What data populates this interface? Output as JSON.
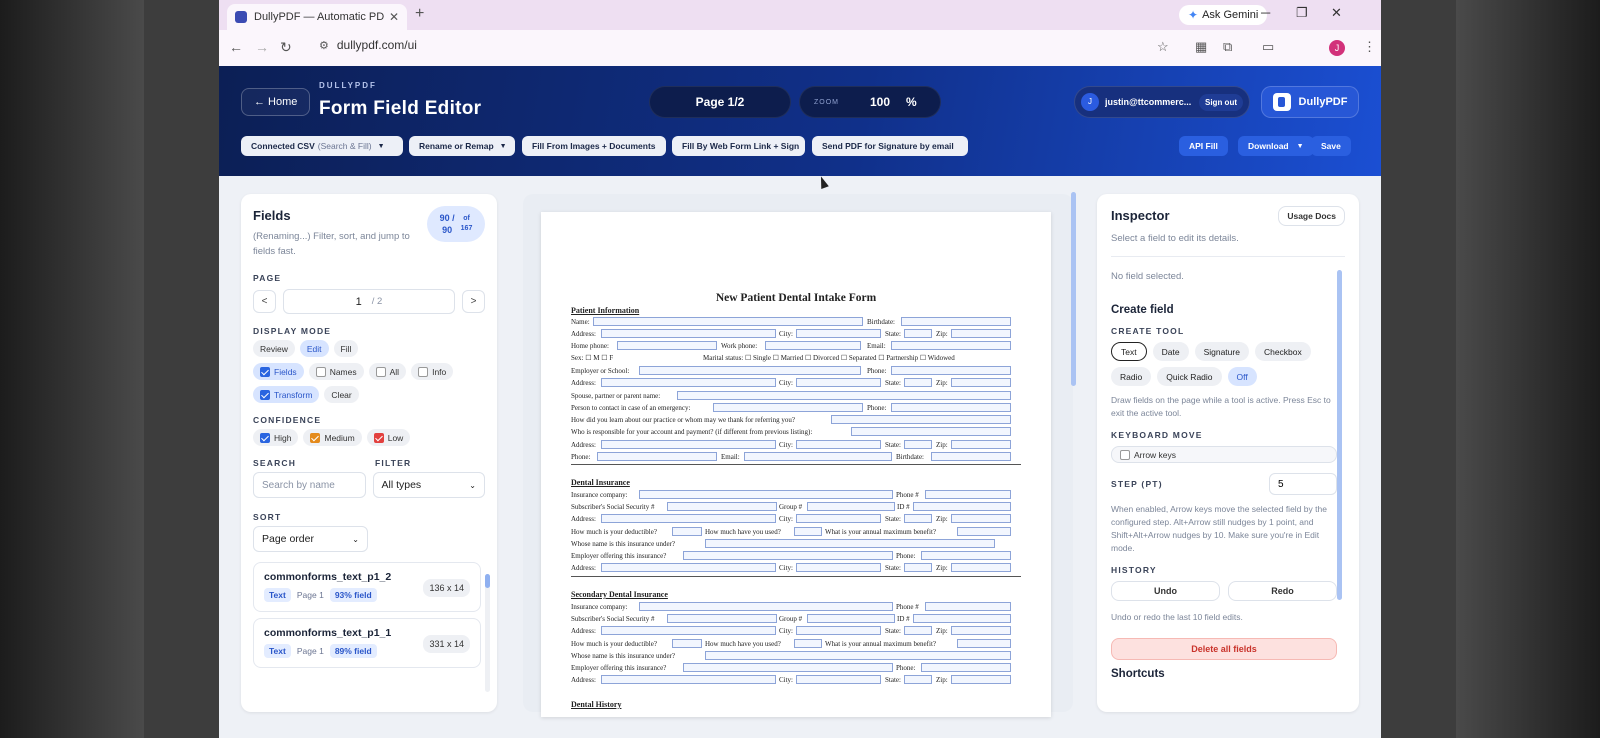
{
  "browser": {
    "tab_title": "DullyPDF — Automatic PDF to F",
    "tab_close": "✕",
    "new_tab": "+",
    "gemini": "Ask Gemini",
    "url": "dullypdf.com/ui",
    "profile_initial": "J"
  },
  "header": {
    "home": "← Home",
    "brand": "DULLYPDF",
    "title": "Form Field Editor",
    "page_indicator": "Page 1/2",
    "zoom_label": "ZOOM",
    "zoom_value": "100",
    "zoom_unit": "%",
    "user_initial": "J",
    "user_email": "justin@ttcommerc...",
    "sign_out": "Sign out",
    "product": "DullyPDF"
  },
  "toolbar": {
    "connected_csv": "Connected CSV",
    "connected_csv_hint": "(Search & Fill)",
    "rename_remap": "Rename or Remap",
    "fill_images": "Fill From Images + Documents",
    "fill_web": "Fill By Web Form Link + Sign",
    "send_sig": "Send PDF for Signature by email",
    "api_fill": "API Fill",
    "download": "Download",
    "save": "Save"
  },
  "fields_panel": {
    "title": "Fields",
    "subtitle": "(Renaming...) Filter, sort, and jump to fields fast.",
    "count_a": "90 /",
    "count_b": "90",
    "count_of": "of",
    "count_total": "167",
    "page_label": "PAGE",
    "page_current": "1",
    "page_of": "/ 2",
    "prev": "<",
    "next": ">",
    "display_mode_label": "DISPLAY MODE",
    "modes": [
      "Review",
      "Edit",
      "Fill"
    ],
    "toggles": [
      "Fields",
      "Names",
      "All",
      "Info"
    ],
    "transform": "Transform",
    "clear": "Clear",
    "confidence_label": "CONFIDENCE",
    "confidence": [
      "High",
      "Medium",
      "Low"
    ],
    "search_label": "SEARCH",
    "search_placeholder": "Search by name",
    "filter_label": "FILTER",
    "filter_value": "All types",
    "sort_label": "SORT",
    "sort_value": "Page order",
    "items": [
      {
        "name": "commonforms_text_p1_2",
        "type": "Text",
        "page": "Page 1",
        "conf": "93% field",
        "size": "136 x 14"
      },
      {
        "name": "commonforms_text_p1_1",
        "type": "Text",
        "page": "Page 1",
        "conf": "89% field",
        "size": "331 x 14"
      }
    ]
  },
  "document": {
    "title": "New Patient Dental Intake Form",
    "sections": [
      "Patient Information",
      "Dental Insurance",
      "Secondary Dental Insurance",
      "Dental History"
    ],
    "labels": {
      "name": "Name:",
      "birthdate": "Birthdate:",
      "address": "Address:",
      "city": "City:",
      "state": "State:",
      "zip": "Zip:",
      "home_phone": "Home phone:",
      "work_phone": "Work phone:",
      "email": "Email:",
      "sex": "Sex:",
      "m": "M",
      "f": "F",
      "marital": "Marital status:",
      "single": "Single",
      "married": "Married",
      "divorced": "Divorced",
      "separated": "Separated",
      "partnership": "Partnership",
      "widowed": "Widowed",
      "employer": "Employer or School:",
      "phone": "Phone:",
      "spouse": "Spouse, partner or parent name:",
      "emergency": "Person to contact in case of an emergency:",
      "referral": "How did you learn about our practice or whom may we thank for referring you?",
      "responsible": "Who is responsible for your account and payment? (if different from previous listing):",
      "ins_company": "Insurance company:",
      "phone_hash": "Phone #",
      "ssn": "Subscriber's Social Security #",
      "group": "Group #",
      "id": "ID #",
      "deductible": "How much is your deductible?",
      "used": "How much have you used?",
      "annual": "What is your annual maximum benefit?",
      "whose": "Whose name is this insurance under?",
      "emp_ins": "Employer offering this insurance?"
    }
  },
  "inspector": {
    "title": "Inspector",
    "usage_docs": "Usage Docs",
    "subtitle": "Select a field to edit its details.",
    "no_field": "No field selected.",
    "create_field": "Create field",
    "create_tool_label": "CREATE TOOL",
    "tools": [
      "Text",
      "Date",
      "Signature",
      "Checkbox",
      "Radio",
      "Quick Radio",
      "Off"
    ],
    "tool_help": "Draw fields on the page while a tool is active. Press Esc to exit the active tool.",
    "keyboard_label": "KEYBOARD MOVE",
    "arrow_keys": "Arrow keys",
    "step_label": "STEP (PT)",
    "step_value": "5",
    "step_help": "When enabled, Arrow keys move the selected field by the configured step. Alt+Arrow still nudges by 1 point, and Shift+Alt+Arrow nudges by 10. Make sure you're in Edit mode.",
    "history_label": "HISTORY",
    "undo": "Undo",
    "redo": "Redo",
    "history_help": "Undo or redo the last 10 field edits.",
    "delete_all": "Delete all fields",
    "shortcuts": "Shortcuts"
  }
}
